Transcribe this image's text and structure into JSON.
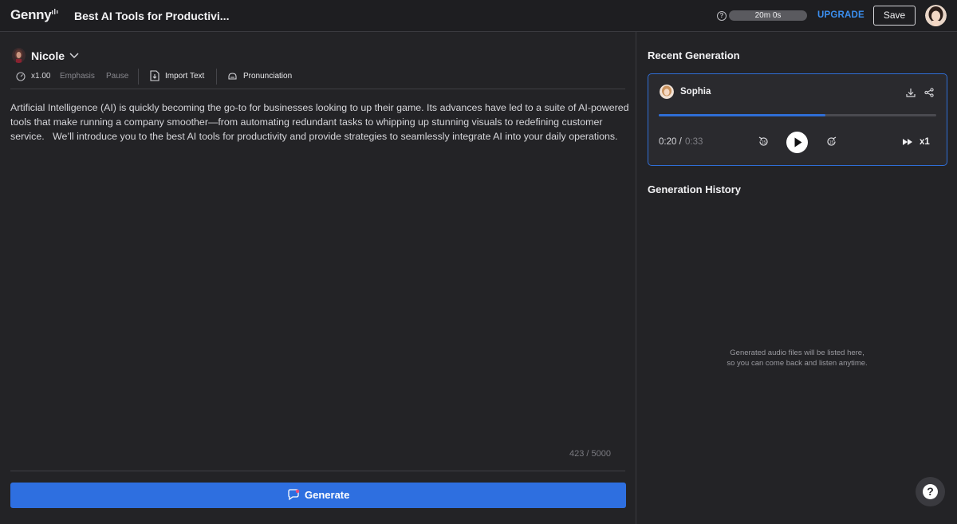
{
  "app": {
    "logo": "Genny",
    "document_title": "Best AI Tools for Productivi...",
    "timer": "20m 0s",
    "upgrade_label": "UPGRADE",
    "save_label": "Save",
    "help_icon": "question-circle-icon"
  },
  "editor": {
    "voice_name": "Nicole",
    "toolbar": {
      "speed": "x1.00",
      "emphasis": "Emphasis",
      "pause": "Pause",
      "import_text": "Import Text",
      "pronunciation": "Pronunciation"
    },
    "text": "Artificial Intelligence (AI) is quickly becoming the go-to for businesses looking to up their game. Its advances have led to a suite of AI-powered tools that make running a company smoother—from automating redundant tasks to whipping up stunning visuals to redefining customer service.   We’ll introduce you to the best AI tools for productivity and provide strategies to seamlessly integrate AI into your daily operations.",
    "char_count": "423 / 5000",
    "generate_label": "Generate"
  },
  "recent": {
    "title": "Recent Generation",
    "voice_name": "Sophia",
    "progress_fraction": 0.6,
    "time_current": "0:20 /",
    "time_total": "0:33",
    "speed": "x1",
    "accent_color": "#2f6ed6"
  },
  "history": {
    "title": "Generation History",
    "empty_line1": "Generated audio files will be listed here,",
    "empty_line2": "so you can come back and listen anytime."
  },
  "help_fab_label": "?"
}
